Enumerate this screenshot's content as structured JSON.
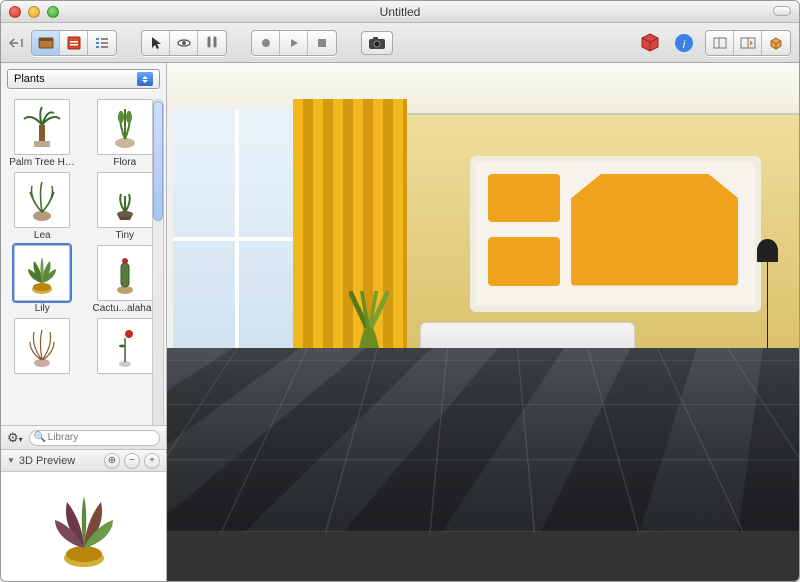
{
  "window": {
    "title": "Untitled"
  },
  "toolbar": {
    "left_icons": [
      "expand-icon",
      "library-panel-icon",
      "inspector-panel-icon",
      "list-panel-icon"
    ],
    "tool_icons": [
      "pointer-icon",
      "orbit-icon",
      "walk-icon"
    ],
    "render_icons": [
      "record-icon",
      "play-icon",
      "stop-icon"
    ],
    "camera_icon": "camera-icon",
    "right_icons": [
      "package-icon",
      "info-icon",
      "view-2d-icon",
      "view-split-icon",
      "view-3d-icon"
    ]
  },
  "sidebar": {
    "category": "Plants",
    "items": [
      {
        "label": "Palm Tree High",
        "icon": "palm"
      },
      {
        "label": "Flora",
        "icon": "flora"
      },
      {
        "label": "Lea",
        "icon": "lea"
      },
      {
        "label": "Tiny",
        "icon": "tiny"
      },
      {
        "label": "Lily",
        "icon": "lily",
        "selected": true
      },
      {
        "label": "Cactu...alahari",
        "icon": "cactus"
      },
      {
        "label": "",
        "icon": "grass"
      },
      {
        "label": "",
        "icon": "rose"
      }
    ],
    "search_placeholder": "Library",
    "preview_label": "3D Preview"
  }
}
